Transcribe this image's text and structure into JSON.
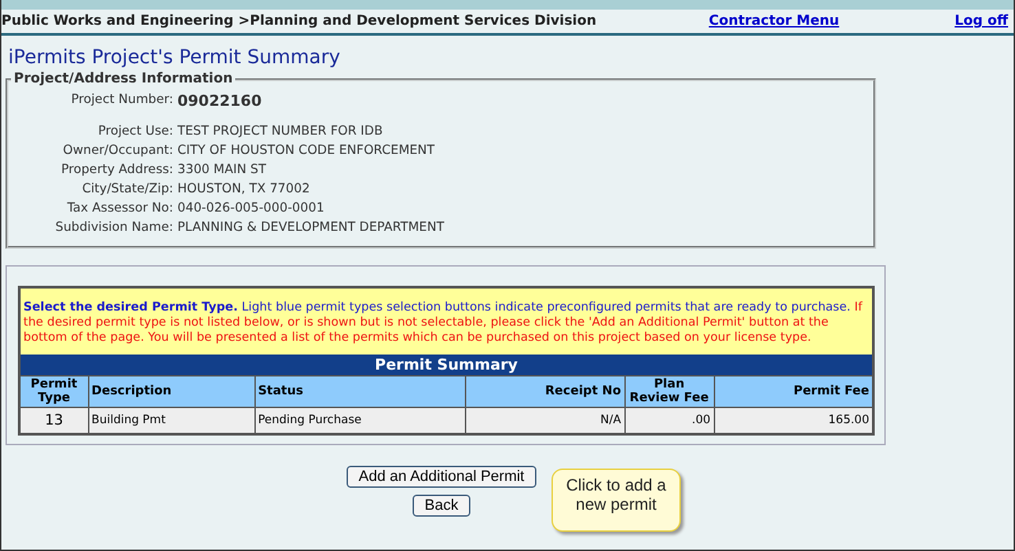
{
  "header": {
    "breadcrumb": "Public Works and Engineering >Planning and Development Services Division",
    "links": [
      "Contractor Menu",
      "Log off"
    ]
  },
  "title": "iPermits Project's Permit Summary",
  "project_info": {
    "legend": "Project/Address Information",
    "fields": [
      {
        "label": "Project Number:",
        "value": "09022160",
        "kind": "emphasis"
      },
      {
        "label": "Project Use:",
        "value": "TEST PROJECT NUMBER FOR IDB",
        "kind": "plain"
      },
      {
        "label": "Owner/Occupant:",
        "value": "CITY OF HOUSTON CODE ENFORCEMENT",
        "kind": "plain"
      },
      {
        "label": "Property Address:",
        "value": "3300 MAIN ST",
        "kind": "plain"
      },
      {
        "label": "City/State/Zip:",
        "value": "HOUSTON, TX  77002",
        "kind": "plain"
      },
      {
        "label": "Tax Assessor No:",
        "value": "040-026-005-000-0001",
        "kind": "plain"
      },
      {
        "label": "Subdivision Name:",
        "value": "PLANNING & DEVELOPMENT DEPARTMENT",
        "kind": "plain"
      }
    ]
  },
  "notice": {
    "intro": "**Select the desired Permit Type.**  Light blue permit types selection buttons indicate preconfigured permits that are ready to purchase.",
    "warning": "If the desired permit type is not listed below, or is shown but is not selectable, please click the 'Add an Additional Permit' button at the bottom of the page. You will be presented a list of the permits which can be purchased on this project based on your license type."
  },
  "table": {
    "caption": "Permit Summary",
    "columns": [
      "Permit Type",
      "Description",
      "Status",
      "Receipt No",
      "Plan Review Fee",
      "Permit Fee"
    ],
    "rows": [
      [
        "13",
        "Building Pmt",
        "Pending Purchase",
        "N/A",
        ".00",
        "165.00"
      ]
    ]
  },
  "buttons": [
    "Add an Additional Permit",
    "Back"
  ],
  "callout": "Click to add a new permit"
}
